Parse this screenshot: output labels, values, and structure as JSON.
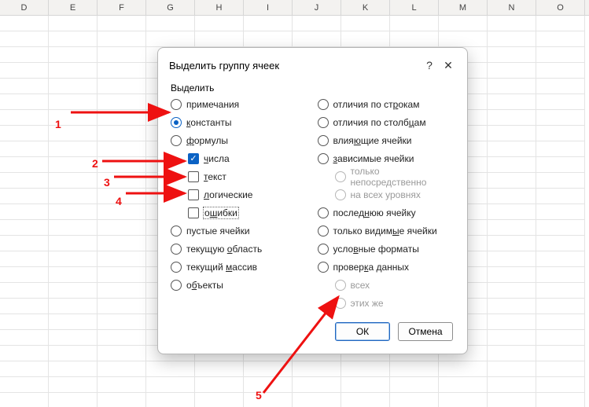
{
  "columns": [
    "D",
    "E",
    "F",
    "G",
    "H",
    "I",
    "J",
    "K",
    "L",
    "M",
    "N",
    "O"
  ],
  "dialog": {
    "title": "Выделить группу ячеек",
    "help_icon": "?",
    "close_icon": "✕",
    "section": "Выделить",
    "left": {
      "notes": "примечания",
      "constants": "константы",
      "formulas": "формулы",
      "numbers": "числа",
      "text": "текст",
      "logical": "логические",
      "errors": "ошибки",
      "blanks": "пустые ячейки",
      "current_region": "текущую область",
      "current_array": "текущий массив",
      "objects": "объекты"
    },
    "right": {
      "row_diff": "отличия по строкам",
      "col_diff": "отличия по столбцам",
      "precedents": "влияющие ячейки",
      "dependents": "зависимые ячейки",
      "direct_only": "только непосредственно",
      "all_levels": "на всех уровнях",
      "last_cell": "последнюю ячейку",
      "visible_only": "только видимые ячейки",
      "cond_formats": "условные форматы",
      "data_validation": "проверка данных",
      "all": "всех",
      "same": "этих же"
    },
    "ok": "ОК",
    "cancel": "Отмена"
  },
  "annotations": {
    "n1": "1",
    "n2": "2",
    "n3": "3",
    "n4": "4",
    "n5": "5"
  }
}
